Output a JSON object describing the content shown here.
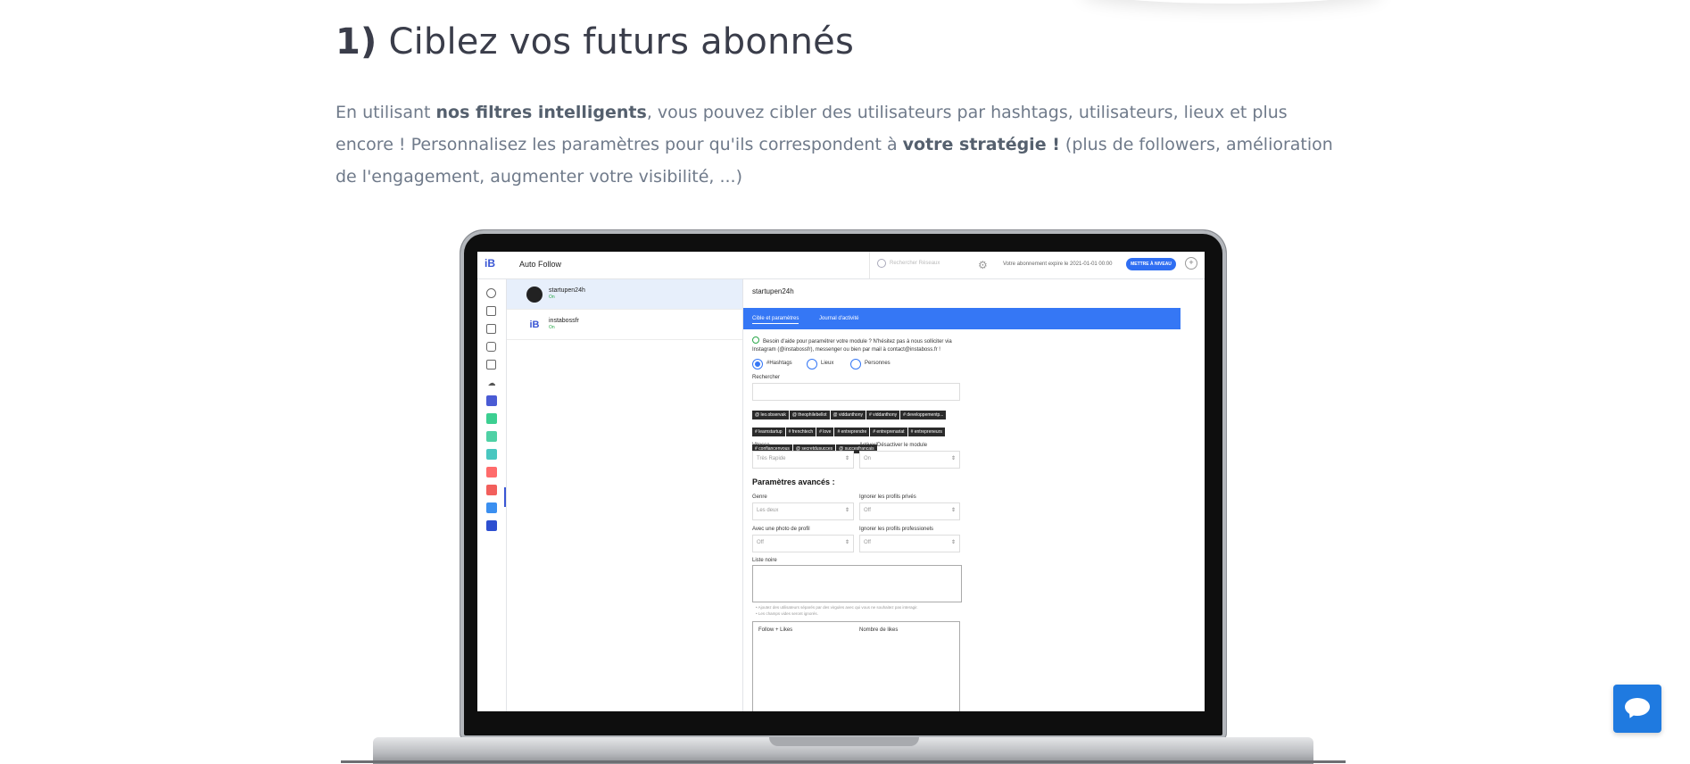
{
  "heading": {
    "number": "1)",
    "text": "Ciblez vos futurs abonnés"
  },
  "intro": {
    "p1": "En utilisant ",
    "p1_bold": "nos filtres intelligents",
    "p2": ", vous pouvez cibler des utilisateurs par hashtags, utilisateurs, lieux et plus encore ! Personnalisez les paramètres pour qu'ils correspondent à ",
    "p2_bold": "votre stratégie !",
    "p3": " (plus de followers, amélioration de l'engagement, augmenter votre visibilité, ...)"
  },
  "app": {
    "logo": "iB",
    "page_title": "Auto Follow",
    "search_placeholder": "Rechercher Réseaux",
    "subscription_text": "Votre abonnement expire le 2021-01-01 00:00",
    "upgrade_label": "METTRE À NIVEAU",
    "accounts": [
      {
        "name": "startupen24h",
        "status": "On"
      },
      {
        "name": "instabossfr",
        "status": "On"
      }
    ],
    "detail_title": "startupen24h",
    "tabs": [
      "Cible et paramètres",
      "Journal d'activité"
    ],
    "help_text": "Besoin d'aide pour paramétrer votre module ? N'hésitez pas à nous solliciter via Instagram (@instabossfr), messenger ou bien par mail à contact@instaboss.fr !",
    "radio_options": [
      "#Hashtags",
      "Lieux",
      "Personnes"
    ],
    "search_label": "Rechercher",
    "chips": [
      "@ leo.observak",
      "@ theophilebellot",
      "@ viddanthony",
      "# viddanthony",
      "# developpementp...",
      "# learnstartup",
      "# frenchtech",
      "# love",
      "# entreprendre",
      "# entreprenariat",
      "# entrepreneurs",
      "# confiancenvous",
      "@ secretdusucces",
      "@ succesfrancais"
    ],
    "vitesse_label": "Vitesse",
    "vitesse_value": "Très Rapide",
    "toggle_label": "Activer/Désactiver le module",
    "toggle_value": "On",
    "advanced_title": "Paramètres avancés :",
    "genre_label": "Genre",
    "genre_value": "Les deux",
    "private_label": "Ignorer les profils privés",
    "private_value": "Off",
    "photo_label": "Avec une photo de profil",
    "photo_value": "Off",
    "pro_label": "Ignorer les profils professionels",
    "pro_value": "Off",
    "blacklist_label": "Liste noire",
    "hint1": "• Ajoutez des utilisateurs séparés par des virgules avec qui vous ne souhaitez pas interagir.",
    "hint2": "• Les champs vides seront ignorés.",
    "follow_likes_label": "Follow + Likes",
    "likes_count_label": "Nombre de likes"
  },
  "colors": {
    "accent": "#3577f5",
    "heading": "#3a3d4a",
    "body_text": "#6f7a8a",
    "chat": "#1f7ae0"
  },
  "icons": {
    "chat": "chat-bubble-icon"
  }
}
